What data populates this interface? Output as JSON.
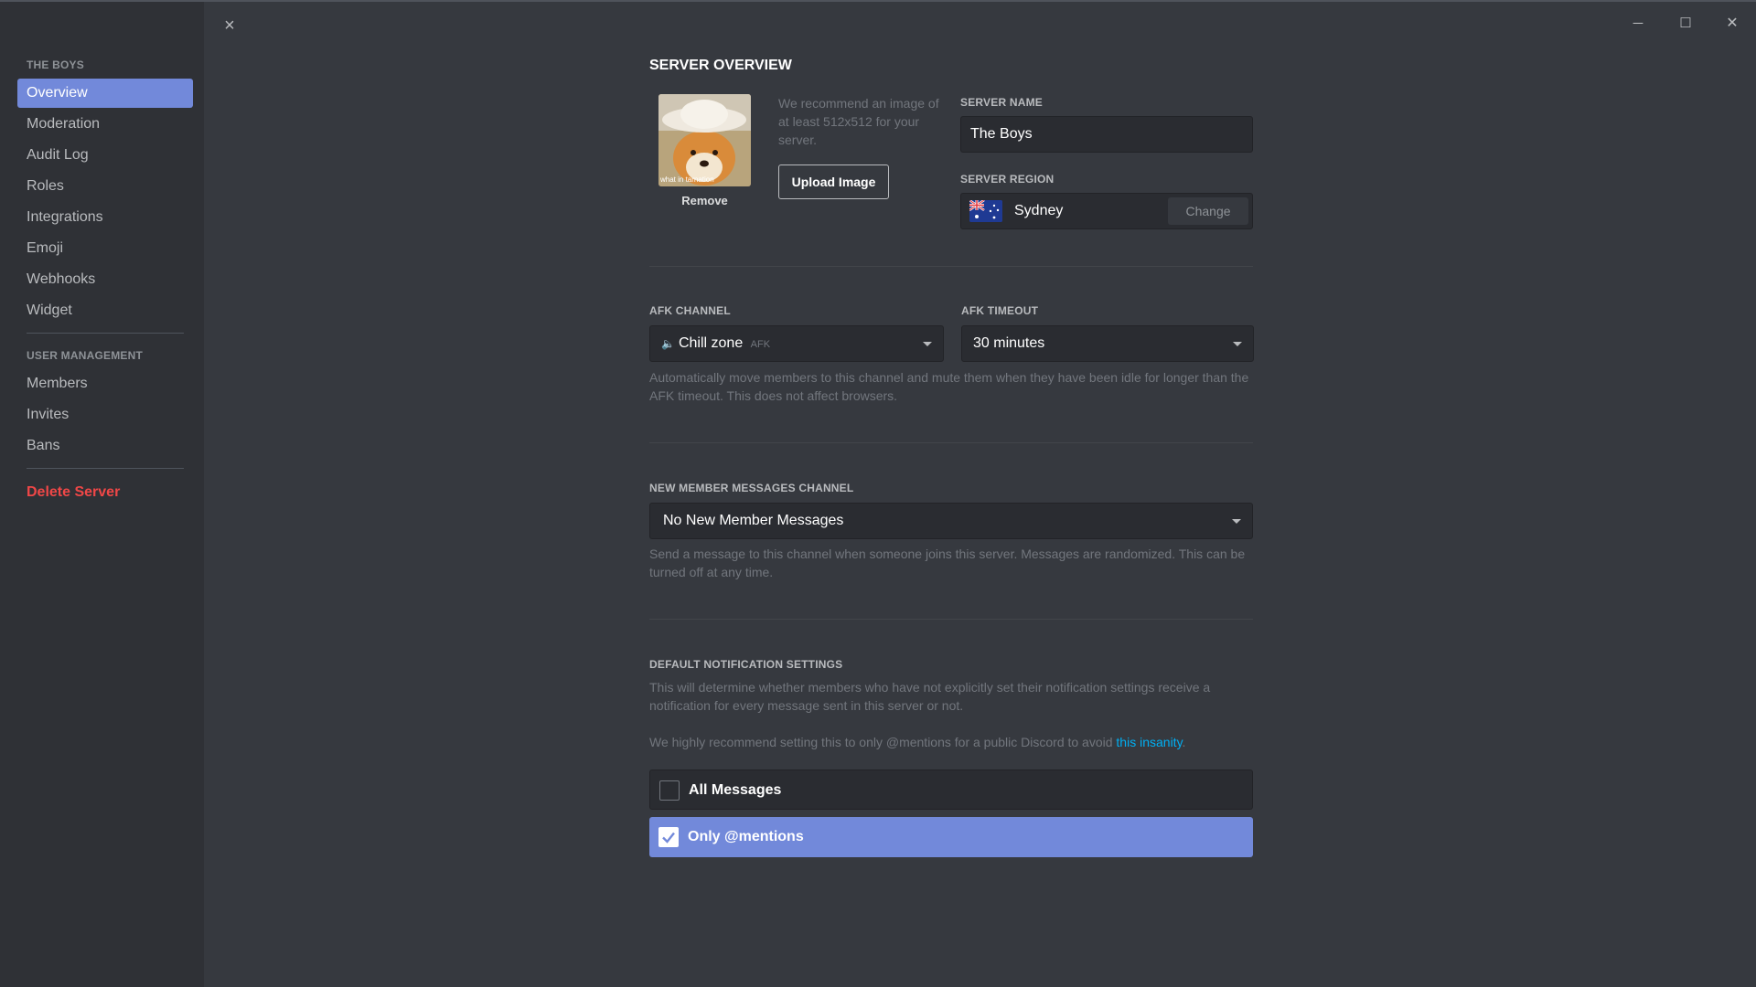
{
  "window": {
    "close_label": "×",
    "min_label": "─",
    "max_label": "☐",
    "close_win_label": "✕"
  },
  "sidebar": {
    "server_header": "THE BOYS",
    "items": [
      {
        "label": "Overview",
        "active": true
      },
      {
        "label": "Moderation"
      },
      {
        "label": "Audit Log"
      },
      {
        "label": "Roles"
      },
      {
        "label": "Integrations"
      },
      {
        "label": "Emoji"
      },
      {
        "label": "Webhooks"
      },
      {
        "label": "Widget"
      }
    ],
    "user_mgmt_header": "USER MANAGEMENT",
    "user_items": [
      {
        "label": "Members"
      },
      {
        "label": "Invites"
      },
      {
        "label": "Bans"
      }
    ],
    "delete_label": "Delete Server"
  },
  "overview": {
    "title": "SERVER OVERVIEW",
    "avatar_caption": "what in tarnation",
    "remove_label": "Remove",
    "image_hint": "We recommend an image of at least 512x512 for your server.",
    "upload_label": "Upload Image",
    "server_name_label": "SERVER NAME",
    "server_name_value": "The Boys",
    "server_region_label": "SERVER REGION",
    "server_region_value": "Sydney",
    "change_label": "Change"
  },
  "afk": {
    "channel_label": "AFK CHANNEL",
    "channel_icon": "speaker-icon",
    "channel_value": "Chill zone",
    "channel_tag": "AFK",
    "timeout_label": "AFK TIMEOUT",
    "timeout_value": "30 minutes",
    "hint": "Automatically move members to this channel and mute them when they have been idle for longer than the AFK timeout. This does not affect browsers."
  },
  "new_member": {
    "label": "NEW MEMBER MESSAGES CHANNEL",
    "value": "No New Member Messages",
    "hint": "Send a message to this channel when someone joins this server. Messages are randomized. This can be turned off at any time."
  },
  "notifications": {
    "label": "DEFAULT NOTIFICATION SETTINGS",
    "hint1": "This will determine whether members who have not explicitly set their notification settings receive a notification for every message sent in this server or not.",
    "hint2_prefix": "We highly recommend setting this to only @mentions for a public Discord to avoid ",
    "hint2_link": "this insanity",
    "hint2_suffix": ".",
    "options": [
      {
        "label": "All Messages",
        "checked": false
      },
      {
        "label": "Only @mentions",
        "checked": true
      }
    ]
  },
  "colors": {
    "accent": "#7289da",
    "danger": "#f04747",
    "link": "#00b0f4"
  }
}
